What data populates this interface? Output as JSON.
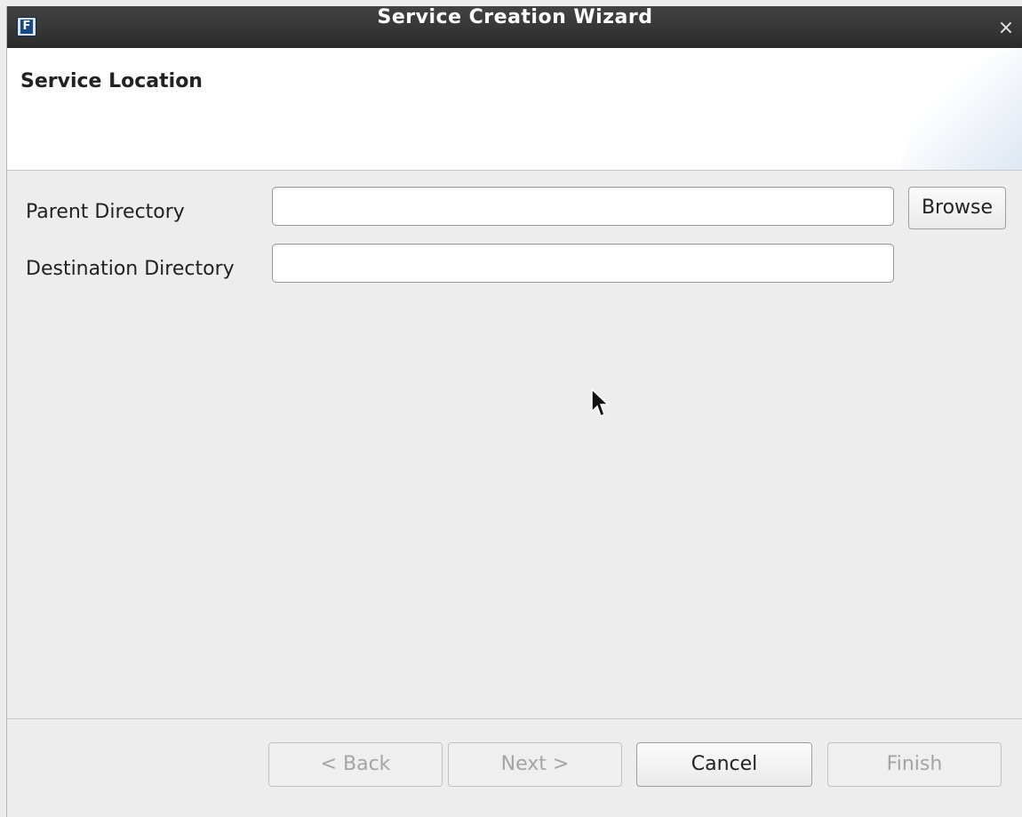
{
  "window": {
    "title": "Service Creation Wizard",
    "close_glyph": "×",
    "app_icon_glyph": "F"
  },
  "header": {
    "title": "Service Location"
  },
  "form": {
    "parent_directory": {
      "label": "Parent Directory",
      "value": ""
    },
    "destination_directory": {
      "label": "Destination Directory",
      "value": ""
    },
    "browse_label": "Browse"
  },
  "footer": {
    "back_label": "< Back",
    "next_label": "Next >",
    "cancel_label": "Cancel",
    "finish_label": "Finish"
  },
  "icons": {
    "close": "close-icon",
    "app": "app-icon",
    "cursor": "mouse-pointer-icon"
  }
}
